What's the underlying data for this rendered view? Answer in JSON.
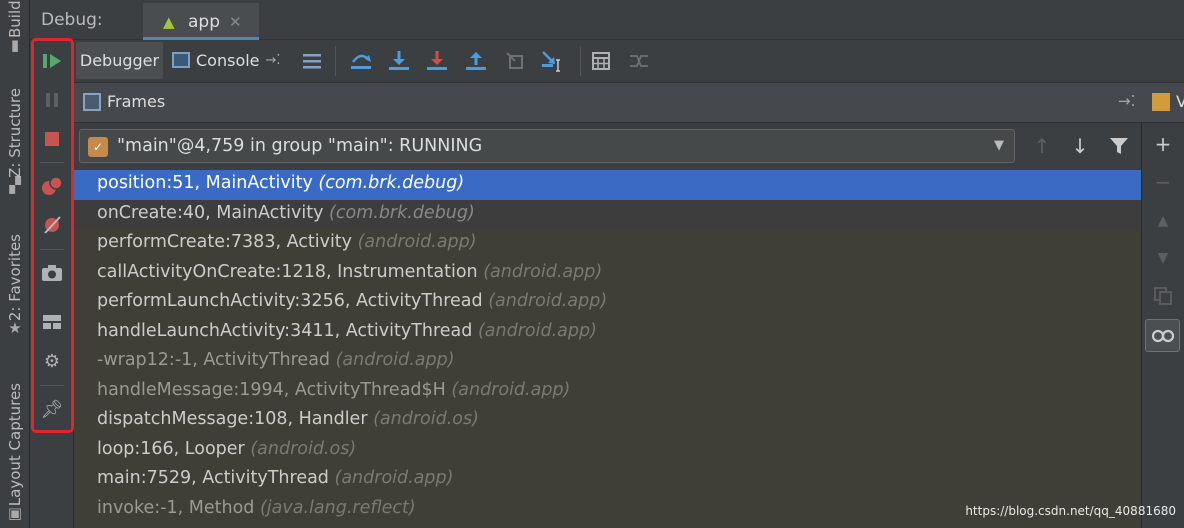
{
  "left_stripe": {
    "build": "Build",
    "structure": "Z: Structure",
    "favorites": "2: Favorites",
    "layout_captures": "Layout Captures"
  },
  "title_bar": {
    "label": "Debug:",
    "tab_label": "app"
  },
  "toolbar": {
    "debugger_tab": "Debugger",
    "console_tab": "Console"
  },
  "frames_panel": {
    "title": "Frames",
    "variables_label": "V"
  },
  "thread_selector": {
    "value": "\"main\"@4,759 in group \"main\": RUNNING"
  },
  "frames": [
    {
      "method": "position:51, MainActivity",
      "pkg": "(com.brk.debug)",
      "selected": true
    },
    {
      "method": "onCreate:40, MainActivity",
      "pkg": "(com.brk.debug)"
    },
    {
      "method": "performCreate:7383, Activity",
      "pkg": "(android.app)"
    },
    {
      "method": "callActivityOnCreate:1218, Instrumentation",
      "pkg": "(android.app)"
    },
    {
      "method": "performLaunchActivity:3256, ActivityThread",
      "pkg": "(android.app)"
    },
    {
      "method": "handleLaunchActivity:3411, ActivityThread",
      "pkg": "(android.app)"
    },
    {
      "method": "-wrap12:-1, ActivityThread",
      "pkg": "(android.app)"
    },
    {
      "method": "handleMessage:1994, ActivityThread$H",
      "pkg": "(android.app)"
    },
    {
      "method": "dispatchMessage:108, Handler",
      "pkg": "(android.os)"
    },
    {
      "method": "loop:166, Looper",
      "pkg": "(android.os)"
    },
    {
      "method": "main:7529, ActivityThread",
      "pkg": "(android.app)"
    },
    {
      "method": "invoke:-1, Method",
      "pkg": "(java.lang.reflect)"
    }
  ],
  "watermark": "https://blog.csdn.net/qq_40881680",
  "colors": {
    "selection": "#3a6bc4",
    "highlight_frame": "#e0262b",
    "resume": "#59a869",
    "stop": "#c75450"
  }
}
